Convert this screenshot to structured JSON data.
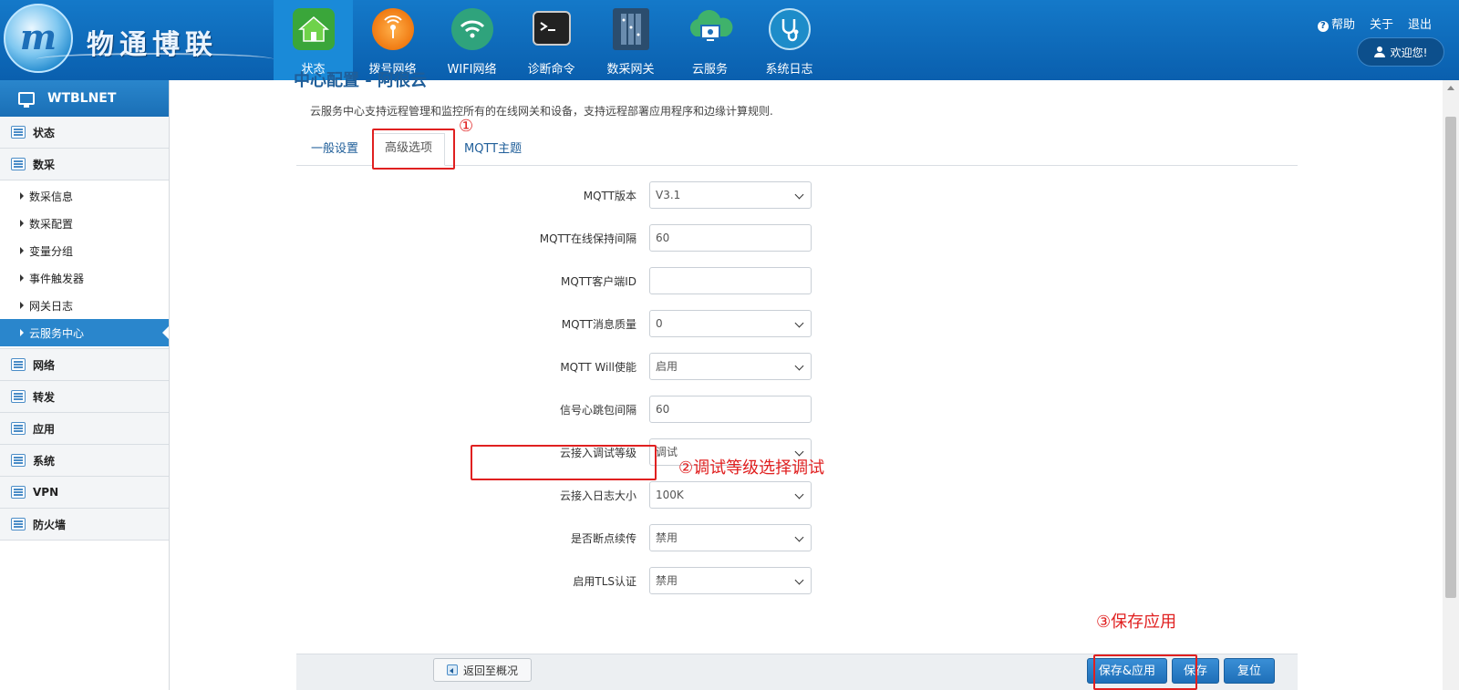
{
  "header": {
    "logo_text": "物通博联",
    "nav": [
      {
        "label": "状态",
        "icon": "house-icon"
      },
      {
        "label": "拨号网络",
        "icon": "dialup-icon"
      },
      {
        "label": "WIFI网络",
        "icon": "wifi-icon"
      },
      {
        "label": "诊断命令",
        "icon": "terminal-icon"
      },
      {
        "label": "数采网关",
        "icon": "gateway-icon"
      },
      {
        "label": "云服务",
        "icon": "cloud-icon"
      },
      {
        "label": "系统日志",
        "icon": "stethoscope-icon"
      }
    ],
    "help": "帮助",
    "about": "关于",
    "logout": "退出",
    "welcome": "欢迎您!"
  },
  "sidebar": {
    "title": "WTBLNET",
    "groups": [
      {
        "label": "状态"
      },
      {
        "label": "数采"
      }
    ],
    "sub_items": [
      "数采信息",
      "数采配置",
      "变量分组",
      "事件触发器",
      "网关日志",
      "云服务中心"
    ],
    "bottom_groups": [
      {
        "label": "网络"
      },
      {
        "label": "转发"
      },
      {
        "label": "应用"
      },
      {
        "label": "系统"
      },
      {
        "label": "VPN"
      },
      {
        "label": "防火墙"
      }
    ]
  },
  "main": {
    "title": "中心配置 - 阿很云",
    "description": "云服务中心支持远程管理和监控所有的在线网关和设备，支持远程部署应用程序和边缘计算规则.",
    "tabs": [
      "一般设置",
      "高级选项",
      "MQTT主题"
    ],
    "tab_marker": "①",
    "fields": [
      {
        "label": "MQTT版本",
        "value": "V3.1",
        "type": "select"
      },
      {
        "label": "MQTT在线保持间隔",
        "value": "60",
        "type": "input"
      },
      {
        "label": "MQTT客户端ID",
        "value": "",
        "type": "input"
      },
      {
        "label": "MQTT消息质量",
        "value": "0",
        "type": "select"
      },
      {
        "label": "MQTT Will使能",
        "value": "启用",
        "type": "select"
      },
      {
        "label": "信号心跳包间隔",
        "value": "60",
        "type": "input"
      },
      {
        "label": "云接入调试等级",
        "value": "调试",
        "type": "select"
      },
      {
        "label": "云接入日志大小",
        "value": "100K",
        "type": "select"
      },
      {
        "label": "是否断点续传",
        "value": "禁用",
        "type": "select"
      },
      {
        "label": "启用TLS认证",
        "value": "禁用",
        "type": "select"
      }
    ],
    "annotation_2": "②调试等级选择调试",
    "annotation_3": "③保存应用",
    "buttons": {
      "back": "返回至概况",
      "save_apply": "保存&应用",
      "save": "保存",
      "reset": "复位"
    }
  },
  "colors": {
    "header_blue": "#0a5fae",
    "accent_blue": "#2a86cc",
    "annotation_red": "#e02020"
  }
}
